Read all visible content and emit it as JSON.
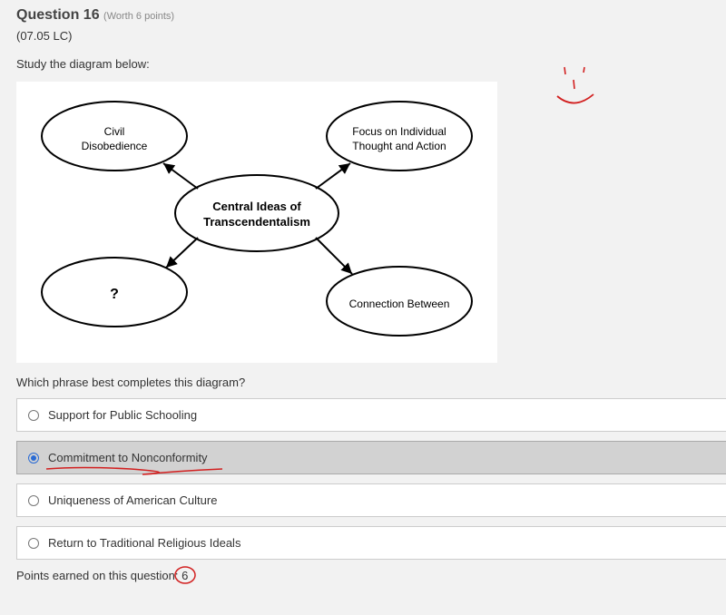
{
  "header": {
    "title_prefix": "Question",
    "number": "16",
    "worth": "(Worth 6 points)",
    "code": "(07.05 LC)"
  },
  "prompt": "Study the diagram below:",
  "diagram": {
    "top_left": "Civil\nDisobedience",
    "top_right": "Focus on Individual\nThought and Action",
    "center": "Central Ideas of\nTranscendentalism",
    "bottom_left": "?",
    "bottom_right": "Connection Between"
  },
  "question_text": "Which phrase best completes this diagram?",
  "options": [
    {
      "label": "Support for Public Schooling",
      "selected": false
    },
    {
      "label": "Commitment to Nonconformity",
      "selected": true
    },
    {
      "label": "Uniqueness of American Culture",
      "selected": false
    },
    {
      "label": "Return to Traditional Religious Ideals",
      "selected": false
    }
  ],
  "points": {
    "label_prefix": "Points earned on this question: ",
    "value": "6"
  },
  "colors": {
    "annotation": "#d22020"
  },
  "chart_data": {
    "type": "diagram",
    "description": "Concept map / web diagram",
    "center_node": "Central Ideas of Transcendentalism",
    "spokes": [
      "Civil Disobedience",
      "Focus on Individual Thought and Action",
      "?",
      "Connection Between"
    ],
    "missing_node": "?",
    "title": "",
    "notes": "Central ellipse connected by arrows to four surrounding ellipses; bottom-left ellipse contains a question mark to be filled in by the answer choices."
  }
}
